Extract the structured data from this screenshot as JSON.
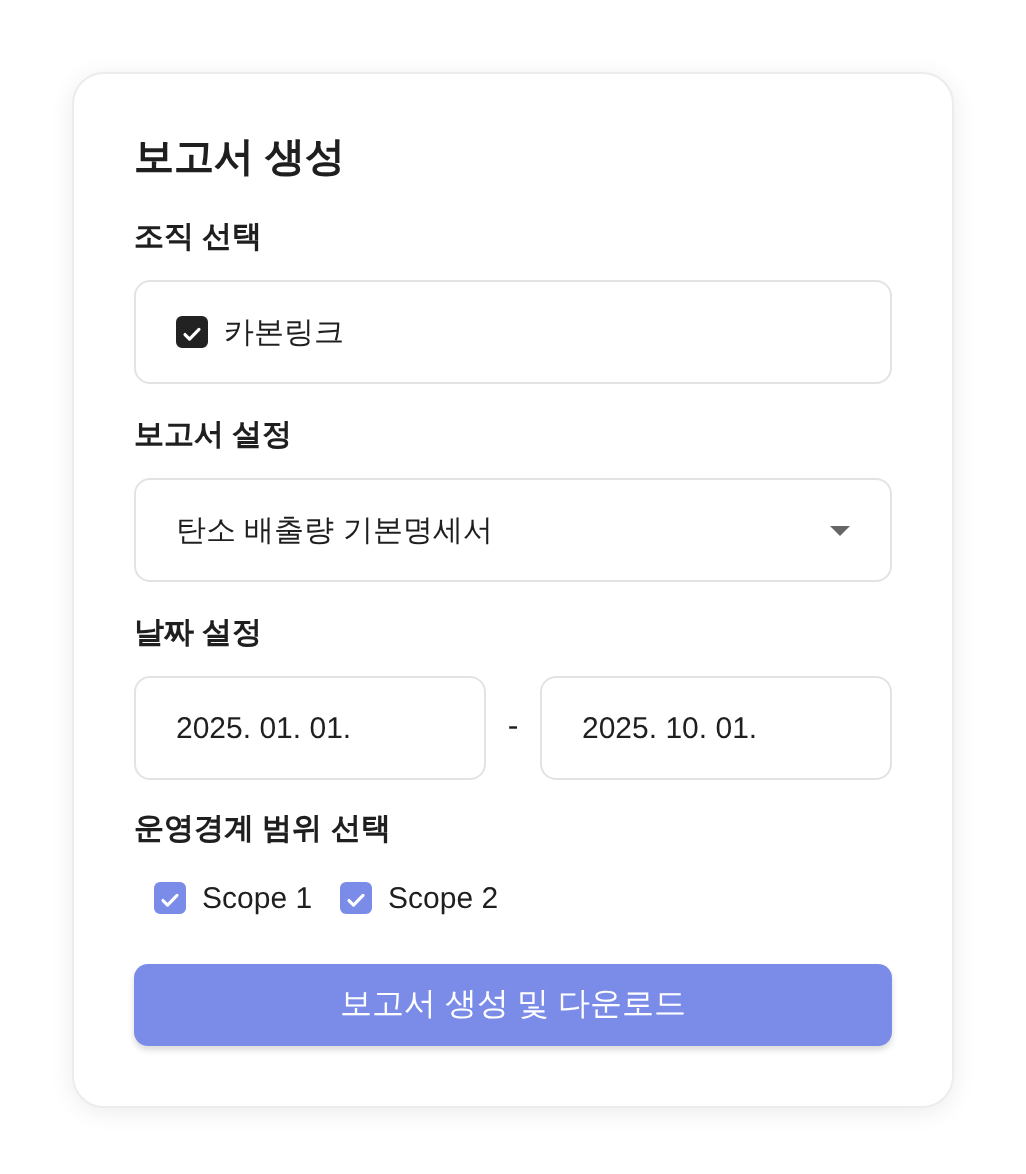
{
  "title": "보고서 생성",
  "organization": {
    "label": "조직 선택",
    "options": [
      {
        "label": "카본링크",
        "checked": true
      }
    ]
  },
  "report_setting": {
    "label": "보고서 설정",
    "value": "탄소 배출량 기본명세서"
  },
  "date_setting": {
    "label": "날짜 설정",
    "start": "2025. 01. 01.",
    "separator": "-",
    "end": "2025. 10. 01."
  },
  "scope": {
    "label": "운영경계 범위 선택",
    "options": [
      {
        "label": "Scope 1",
        "checked": true
      },
      {
        "label": "Scope 2",
        "checked": true
      }
    ]
  },
  "button": "보고서 생성 및 다운로드"
}
